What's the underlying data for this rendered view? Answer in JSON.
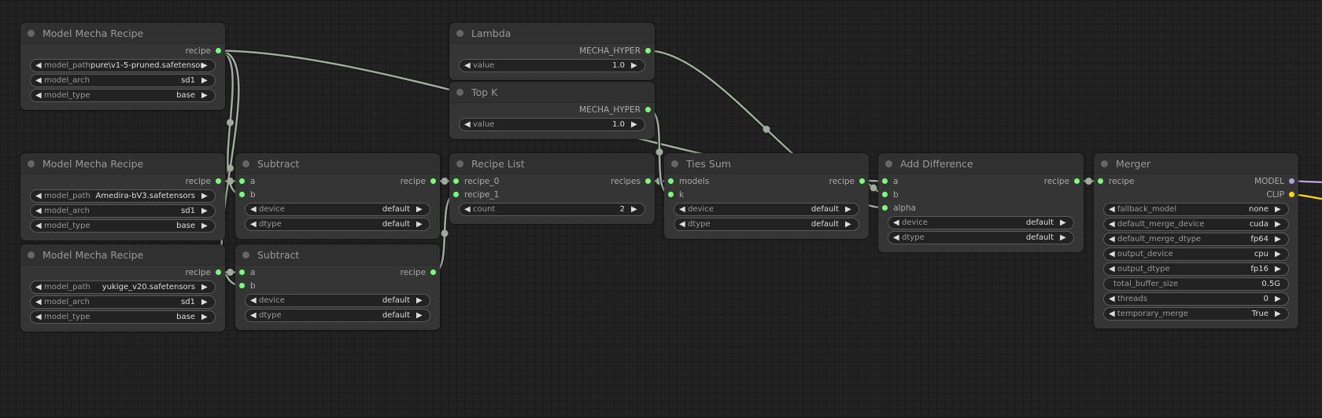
{
  "colors": {
    "link": "#9fae9c",
    "recipe_slot": "#77ff77",
    "model_slot": "#b39ddb",
    "clip_slot": "#ffd500"
  },
  "nodes": [
    {
      "id": "mmr1",
      "title": "Model Mecha Recipe",
      "inputs": [],
      "outputs": [
        {
          "name": "recipe",
          "type": "recipe"
        }
      ],
      "widgets": [
        {
          "label": "model_path",
          "value": "pure\\v1-5-pruned.safetensors",
          "kind": "combo"
        },
        {
          "label": "model_arch",
          "value": "sd1",
          "kind": "combo"
        },
        {
          "label": "model_type",
          "value": "base",
          "kind": "combo"
        }
      ]
    },
    {
      "id": "lambda",
      "title": "Lambda",
      "inputs": [],
      "outputs": [
        {
          "name": "MECHA_HYPER",
          "type": "recipe"
        }
      ],
      "widgets": [
        {
          "label": "value",
          "value": "1.0",
          "kind": "combo"
        }
      ]
    },
    {
      "id": "topk",
      "title": "Top K",
      "inputs": [],
      "outputs": [
        {
          "name": "MECHA_HYPER",
          "type": "recipe"
        }
      ],
      "widgets": [
        {
          "label": "value",
          "value": "1.0",
          "kind": "combo"
        }
      ]
    },
    {
      "id": "mmr2",
      "title": "Model Mecha Recipe",
      "inputs": [],
      "outputs": [
        {
          "name": "recipe",
          "type": "recipe"
        }
      ],
      "widgets": [
        {
          "label": "model_path",
          "value": "Amedira-bV3.safetensors",
          "kind": "combo"
        },
        {
          "label": "model_arch",
          "value": "sd1",
          "kind": "combo"
        },
        {
          "label": "model_type",
          "value": "base",
          "kind": "combo"
        }
      ]
    },
    {
      "id": "sub1",
      "title": "Subtract",
      "inputs": [
        {
          "name": "a"
        },
        {
          "name": "b"
        }
      ],
      "outputs": [
        {
          "name": "recipe",
          "type": "recipe"
        }
      ],
      "widgets": [
        {
          "label": "device",
          "value": "default",
          "kind": "combo"
        },
        {
          "label": "dtype",
          "value": "default",
          "kind": "combo"
        }
      ]
    },
    {
      "id": "rlist",
      "title": "Recipe List",
      "inputs": [
        {
          "name": "recipe_0"
        },
        {
          "name": "recipe_1"
        }
      ],
      "outputs": [
        {
          "name": "recipes",
          "type": "recipe"
        }
      ],
      "widgets": [
        {
          "label": "count",
          "value": "2",
          "kind": "combo"
        }
      ]
    },
    {
      "id": "ties",
      "title": "Ties Sum",
      "inputs": [
        {
          "name": "models"
        },
        {
          "name": "k"
        }
      ],
      "outputs": [
        {
          "name": "recipe",
          "type": "recipe"
        }
      ],
      "widgets": [
        {
          "label": "device",
          "value": "default",
          "kind": "combo"
        },
        {
          "label": "dtype",
          "value": "default",
          "kind": "combo"
        }
      ]
    },
    {
      "id": "adddiff",
      "title": "Add Difference",
      "inputs": [
        {
          "name": "a"
        },
        {
          "name": "b"
        },
        {
          "name": "alpha"
        }
      ],
      "outputs": [
        {
          "name": "recipe",
          "type": "recipe"
        }
      ],
      "widgets": [
        {
          "label": "device",
          "value": "default",
          "kind": "combo"
        },
        {
          "label": "dtype",
          "value": "default",
          "kind": "combo"
        }
      ]
    },
    {
      "id": "merger",
      "title": "Merger",
      "inputs": [
        {
          "name": "recipe"
        }
      ],
      "outputs": [
        {
          "name": "MODEL",
          "type": "model"
        },
        {
          "name": "CLIP",
          "type": "clip"
        }
      ],
      "widgets": [
        {
          "label": "fallback_model",
          "value": "none",
          "kind": "combo"
        },
        {
          "label": "default_merge_device",
          "value": "cuda",
          "kind": "combo"
        },
        {
          "label": "default_merge_dtype",
          "value": "fp64",
          "kind": "combo"
        },
        {
          "label": "output_device",
          "value": "cpu",
          "kind": "combo"
        },
        {
          "label": "output_dtype",
          "value": "fp16",
          "kind": "combo"
        },
        {
          "label": "total_buffer_size",
          "value": "0.5G",
          "kind": "text"
        },
        {
          "label": "threads",
          "value": "0",
          "kind": "combo"
        },
        {
          "label": "temporary_merge",
          "value": "True",
          "kind": "combo"
        }
      ]
    },
    {
      "id": "mmr3",
      "title": "Model Mecha Recipe",
      "inputs": [],
      "outputs": [
        {
          "name": "recipe",
          "type": "recipe"
        }
      ],
      "widgets": [
        {
          "label": "model_path",
          "value": "yukige_v20.safetensors",
          "kind": "combo"
        },
        {
          "label": "model_arch",
          "value": "sd1",
          "kind": "combo"
        },
        {
          "label": "model_type",
          "value": "base",
          "kind": "combo"
        }
      ]
    },
    {
      "id": "sub2",
      "title": "Subtract",
      "inputs": [
        {
          "name": "a"
        },
        {
          "name": "b"
        }
      ],
      "outputs": [
        {
          "name": "recipe",
          "type": "recipe"
        }
      ],
      "widgets": [
        {
          "label": "device",
          "value": "default",
          "kind": "combo"
        },
        {
          "label": "dtype",
          "value": "default",
          "kind": "combo"
        }
      ]
    }
  ],
  "links": [
    {
      "from": "mmr1.0",
      "to": "sub1.1"
    },
    {
      "from": "mmr1.0",
      "to": "sub2.1"
    },
    {
      "from": "mmr1.0",
      "to": "adddiff.0"
    },
    {
      "from": "mmr2.0",
      "to": "sub1.0"
    },
    {
      "from": "mmr3.0",
      "to": "sub2.0"
    },
    {
      "from": "sub1.0",
      "to": "rlist.0"
    },
    {
      "from": "sub2.0",
      "to": "rlist.1"
    },
    {
      "from": "rlist.0",
      "to": "ties.0"
    },
    {
      "from": "topk.0",
      "to": "ties.1"
    },
    {
      "from": "ties.0",
      "to": "adddiff.1"
    },
    {
      "from": "lambda.0",
      "to": "adddiff.2"
    },
    {
      "from": "adddiff.0",
      "to": "merger.0"
    },
    {
      "from": "merger.0",
      "to": "offscreen",
      "type": "model"
    },
    {
      "from": "merger.1",
      "to": "offscreen",
      "type": "clip"
    }
  ]
}
